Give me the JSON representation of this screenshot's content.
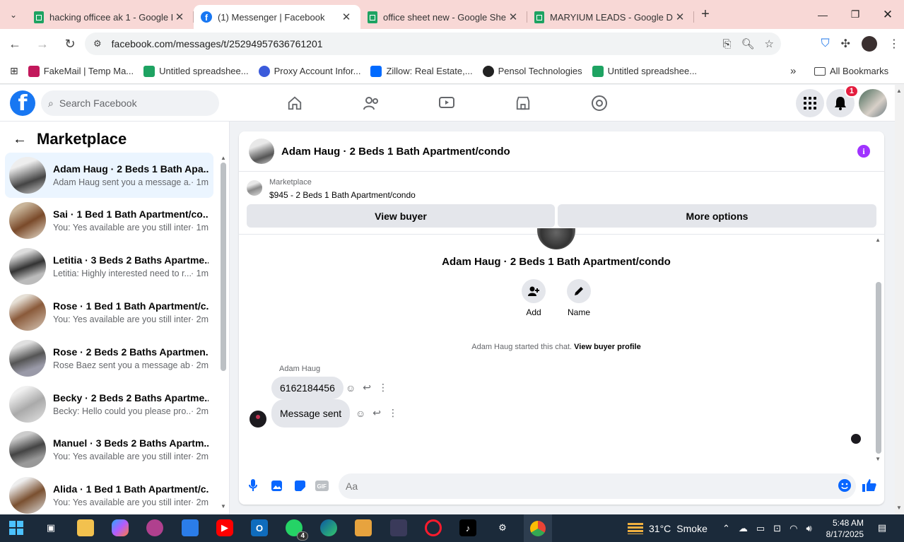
{
  "browser": {
    "tabs": [
      {
        "title": "hacking officee ak 1 - Google D",
        "icon": "sheets-icon",
        "active": false
      },
      {
        "title": "(1) Messenger | Facebook",
        "icon": "facebook-icon",
        "active": true
      },
      {
        "title": "office sheet new - Google Shee",
        "icon": "sheets-icon",
        "active": false
      },
      {
        "title": "MARYIUM LEADS - Google Driv",
        "icon": "sheets-icon",
        "active": false
      }
    ],
    "url": "facebook.com/messages/t/25294957636761201",
    "bookmarks": [
      {
        "label": "FakeMail | Temp Ma...",
        "color": "#c2185b"
      },
      {
        "label": "Untitled spreadshee...",
        "color": "#1ea362"
      },
      {
        "label": "Proxy Account Infor...",
        "color": "#3b5bdb"
      },
      {
        "label": "Zillow: Real Estate,...",
        "color": "#006aff"
      },
      {
        "label": "Pensol Technologies",
        "color": "#222222"
      },
      {
        "label": "Untitled spreadshee...",
        "color": "#1ea362"
      }
    ],
    "all_bookmarks": "All Bookmarks"
  },
  "facebook": {
    "search_placeholder": "Search Facebook",
    "notification_count": "1",
    "brand_color": "#1877f2"
  },
  "marketplace": {
    "title": "Marketplace",
    "conversations": [
      {
        "name": "Adam Haug · 2 Beds 1 Bath Apa...",
        "preview": "Adam Haug sent you a message a...",
        "time": "· 1m",
        "active": true
      },
      {
        "name": "Sai · 1 Bed 1 Bath Apartment/co...",
        "preview": "You: Yes available are you still inter...",
        "time": "· 1m",
        "active": false
      },
      {
        "name": "Letitia · 3 Beds 2 Baths Apartme...",
        "preview": "Letitia: Highly interested need to r...",
        "time": "· 1m",
        "active": false
      },
      {
        "name": "Rose · 1 Bed 1 Bath Apartment/c...",
        "preview": "You: Yes available are you still inter...",
        "time": "· 2m",
        "active": false
      },
      {
        "name": "Rose · 2 Beds 2 Baths Apartmen...",
        "preview": "Rose Baez sent you a message ab...",
        "time": "· 2m",
        "active": false
      },
      {
        "name": "Becky · 2 Beds 2 Baths Apartme...",
        "preview": "Becky: Hello could you please pro...",
        "time": "· 2m",
        "active": false
      },
      {
        "name": "Manuel · 3 Beds 2 Baths Apartm...",
        "preview": "You: Yes available are you still inter...",
        "time": "· 2m",
        "active": false
      },
      {
        "name": "Alida · 1 Bed 1 Bath Apartment/c...",
        "preview": "You: Yes available are you still inter...",
        "time": "· 2m",
        "active": false
      }
    ]
  },
  "chat": {
    "title": "Adam Haug · 2 Beds 1 Bath Apartment/condo",
    "marketplace_label": "Marketplace",
    "listing": "$945 - 2 Beds 1 Bath Apartment/condo",
    "view_buyer": "View buyer",
    "more_options": "More options",
    "hero_title": "Adam Haug · 2 Beds 1 Bath Apartment/condo",
    "add_label": "Add",
    "name_label": "Name",
    "started_text": "Adam Haug started this chat.",
    "view_buyer_profile": "View buyer profile",
    "sender": "Adam Haug",
    "messages": [
      {
        "text": "6162184456",
        "from": "Adam Haug"
      },
      {
        "text": "Message sent",
        "from": "Adam Haug"
      }
    ],
    "composer_placeholder": "Aa",
    "accent": "#0866ff"
  },
  "taskbar": {
    "weather": "31°C",
    "weather_desc": "Smoke",
    "time": "5:48 AM",
    "date": "8/17/2025",
    "whatsapp_badge": "4"
  }
}
